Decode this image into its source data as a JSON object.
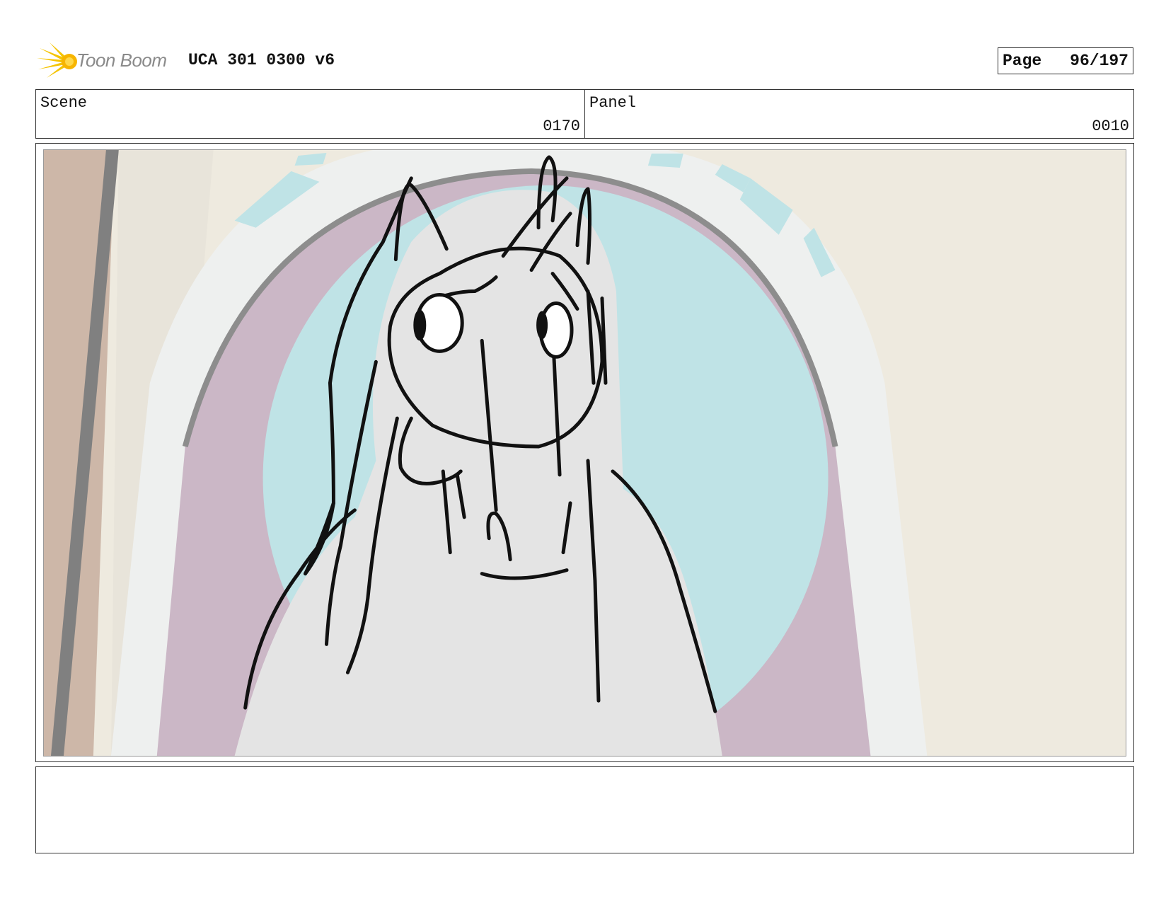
{
  "header": {
    "brand": "Toon Boom",
    "logo_icon": "toon-boom-starburst-icon",
    "title": "UCA 301 0300 v6",
    "page_label": "Page",
    "page_value": "96/197"
  },
  "info": {
    "scene_label": "Scene",
    "scene_value": "0170",
    "panel_label": "Panel",
    "panel_value": "0010"
  },
  "colors": {
    "sky": "#bfe3e6",
    "arch_mauve": "#cbb7c6",
    "arch_white": "#eef0ef",
    "wall": "#eeeadf",
    "horse": "#e4e4e4",
    "logo_yellow": "#f5c400"
  },
  "notes": {
    "text": ""
  }
}
